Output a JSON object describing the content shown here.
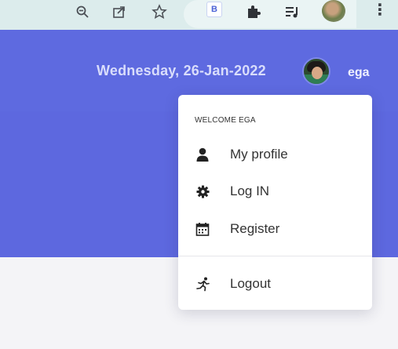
{
  "browser": {
    "toolbar_icons": [
      "zoom-icon",
      "share-icon",
      "star-icon",
      "extension-icon",
      "puzzle-icon",
      "media-icon"
    ],
    "extension_badge": "B",
    "menu_glyph": "⋮"
  },
  "header": {
    "date": "Wednesday, 26-Jan-2022",
    "username": "ega"
  },
  "user_menu": {
    "welcome": "WELCOME EGA",
    "items": [
      {
        "label": "My profile",
        "icon": "user-icon"
      },
      {
        "label": "Log IN",
        "icon": "gear-icon"
      },
      {
        "label": "Register",
        "icon": "calendar-icon"
      },
      {
        "label": "Logout",
        "icon": "running-person-icon"
      }
    ]
  },
  "colors": {
    "header": "#5e6ae0",
    "menu_background": "#ffffff",
    "page": "#f4f4f7"
  }
}
